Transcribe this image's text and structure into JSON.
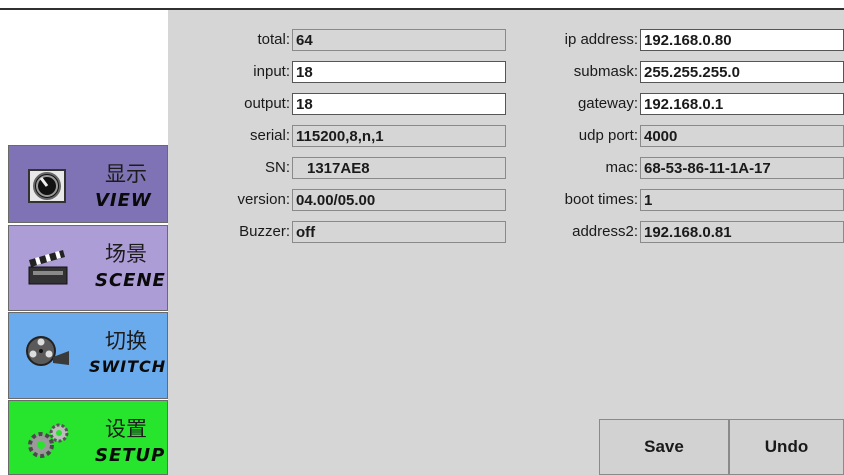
{
  "sidebar": {
    "items": [
      {
        "cn": "显示",
        "en": "VIEW",
        "icon": "dial-icon"
      },
      {
        "cn": "场景",
        "en": "SCENE",
        "icon": "clapperboard-icon"
      },
      {
        "cn": "切换",
        "en": "SWITCH",
        "icon": "film-reel-icon"
      },
      {
        "cn": "设置",
        "en": "SETUP",
        "icon": "gears-icon"
      }
    ],
    "colors": {
      "view": "#7f73b6",
      "scene": "#ad9dd7",
      "switch": "#6aabed",
      "setup": "#27e52c"
    }
  },
  "left_fields": {
    "total": {
      "label": "total:",
      "value": "64"
    },
    "input": {
      "label": "input:",
      "value": "18"
    },
    "output": {
      "label": "output:",
      "value": "18"
    },
    "serial": {
      "label": "serial:",
      "value": "115200,8,n,1"
    },
    "sn": {
      "label": "SN:",
      "value": "1317AE8"
    },
    "version": {
      "label": "version:",
      "value": "04.00/05.00"
    },
    "buzzer": {
      "label": "Buzzer:",
      "value": "off"
    }
  },
  "right_fields": {
    "ip": {
      "label": "ip address:",
      "value": "192.168.0.80"
    },
    "submask": {
      "label": "submask:",
      "value": "255.255.255.0"
    },
    "gateway": {
      "label": "gateway:",
      "value": "192.168.0.1"
    },
    "udp": {
      "label": "udp port:",
      "value": "4000"
    },
    "mac": {
      "label": "mac:",
      "value": "68-53-86-11-1A-17"
    },
    "boot": {
      "label": "boot times:",
      "value": "1"
    },
    "address2": {
      "label": "address2:",
      "value": "192.168.0.81"
    }
  },
  "buttons": {
    "save": "Save",
    "undo": "Undo"
  }
}
